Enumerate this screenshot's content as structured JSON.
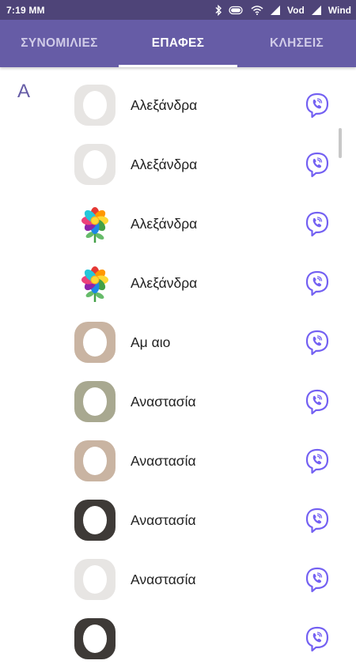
{
  "status_bar": {
    "time": "7:19 ΜΜ",
    "carrier1": "Vod",
    "carrier2": "Wind",
    "icons": [
      "bluetooth-icon",
      "battery-icon",
      "wifi-icon",
      "signal-icon"
    ]
  },
  "tabs": [
    {
      "label": "ΣΥΝΟΜΙΛΙΕΣ",
      "active": false
    },
    {
      "label": "ΕΠΑΦΕΣ",
      "active": true
    },
    {
      "label": "ΚΛΗΣΕΙΣ",
      "active": false
    }
  ],
  "section_letter": "A",
  "contacts": [
    {
      "name": "Αλεξάνδρα",
      "avatar": "photo"
    },
    {
      "name": "Αλεξάνδρα",
      "avatar": "photo"
    },
    {
      "name": "Αλεξάνδρα",
      "avatar": "flower-icon"
    },
    {
      "name": "Αλεξάνδρα",
      "avatar": "flower-icon"
    },
    {
      "name": "Αμ      αιο",
      "avatar": "photo"
    },
    {
      "name": "Αναστασία",
      "avatar": "photo"
    },
    {
      "name": "Αναστασία",
      "avatar": "photo"
    },
    {
      "name": "Αναστασία",
      "avatar": "photo"
    },
    {
      "name": "Αναστασία",
      "avatar": "photo"
    },
    {
      "name": "",
      "avatar": "photo"
    }
  ],
  "colors": {
    "accent": "#665ca6",
    "status_bar": "#4e4478",
    "viber_icon": "#7360f2"
  }
}
